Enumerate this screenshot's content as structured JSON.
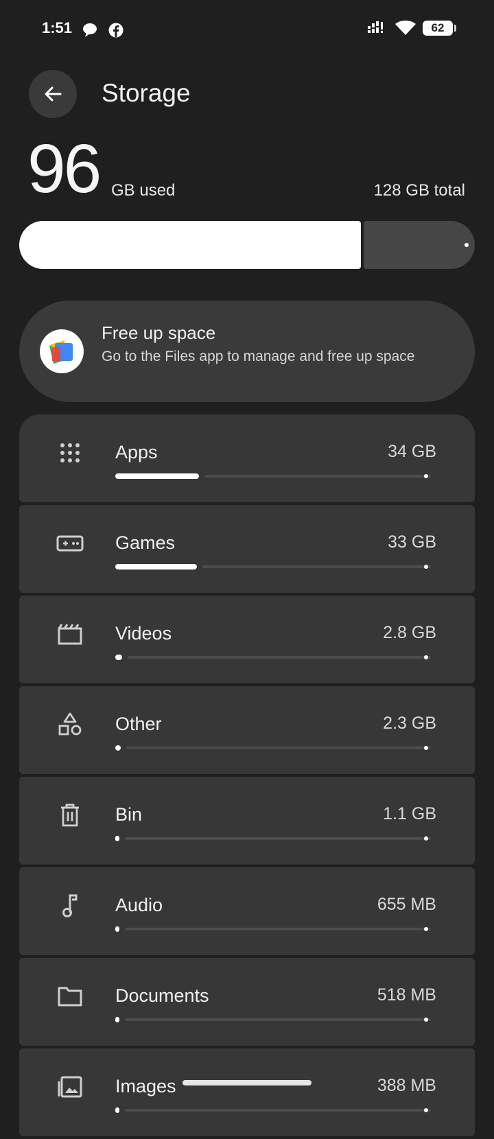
{
  "status_bar": {
    "time": "1:51",
    "battery": "62",
    "icons": [
      "chat-bubble-icon",
      "facebook-icon",
      "signal-icon",
      "wifi-icon",
      "battery-icon"
    ]
  },
  "header": {
    "title": "Storage"
  },
  "summary": {
    "used_value": "96",
    "used_label": "GB used",
    "total_label": "128 GB total",
    "used_fraction": 0.75
  },
  "free_up": {
    "title": "Free up space",
    "description": "Go to the Files app to manage and free up space"
  },
  "categories": [
    {
      "name": "Apps",
      "size": "34 GB",
      "fraction": 0.265,
      "icon": "apps-grid-icon"
    },
    {
      "name": "Games",
      "size": "33 GB",
      "fraction": 0.258,
      "icon": "gamepad-icon"
    },
    {
      "name": "Videos",
      "size": "2.8 GB",
      "fraction": 0.022,
      "icon": "clapperboard-icon"
    },
    {
      "name": "Other",
      "size": "2.3 GB",
      "fraction": 0.018,
      "icon": "shapes-icon"
    },
    {
      "name": "Bin",
      "size": "1.1 GB",
      "fraction": 0.009,
      "icon": "trash-icon"
    },
    {
      "name": "Audio",
      "size": "655 MB",
      "fraction": 0.005,
      "icon": "music-note-icon"
    },
    {
      "name": "Documents",
      "size": "518 MB",
      "fraction": 0.004,
      "icon": "folder-icon"
    },
    {
      "name": "Images",
      "size": "388 MB",
      "fraction": 0.003,
      "icon": "image-icon"
    }
  ],
  "colors": {
    "background": "#1f1f1f",
    "card": "#373737",
    "fill": "#ffffff",
    "track": "#4c4c4c"
  }
}
